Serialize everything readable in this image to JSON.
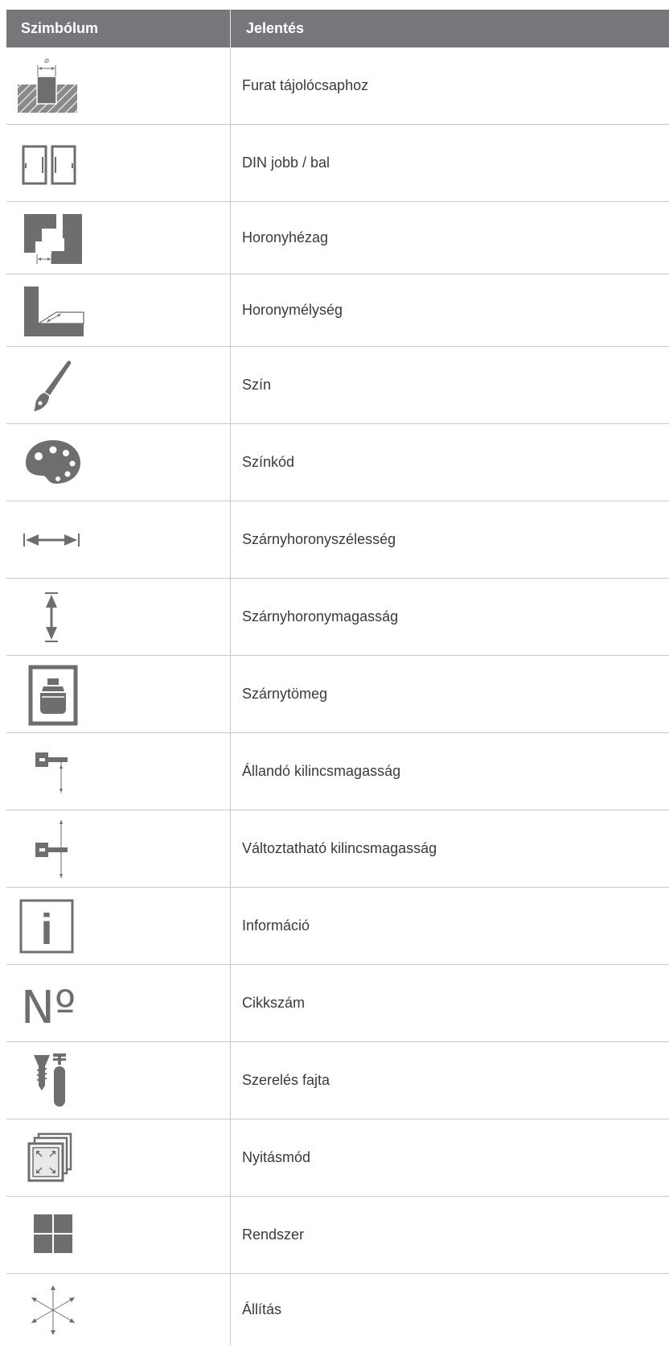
{
  "header": {
    "symbol": "Szimbólum",
    "meaning": "Jelentés"
  },
  "rows": [
    {
      "icon": "drill-hole-icon",
      "label": "Furat tájolócsaphoz",
      "glyph": "⌀"
    },
    {
      "icon": "din-left-right-icon",
      "label": "DIN jobb / bal"
    },
    {
      "icon": "groove-gap-icon",
      "label": "Horonyhézag"
    },
    {
      "icon": "groove-depth-icon",
      "label": "Horonymélység"
    },
    {
      "icon": "paintbrush-icon",
      "label": "Szín"
    },
    {
      "icon": "palette-icon",
      "label": "Színkód"
    },
    {
      "icon": "horizontal-width-icon",
      "label": "Szárnyhoronyszélesség"
    },
    {
      "icon": "vertical-height-icon",
      "label": "Szárnyhoronymagasság"
    },
    {
      "icon": "weight-icon",
      "label": "Szárnytömeg"
    },
    {
      "icon": "fixed-handle-height-icon",
      "label": "Állandó kilincsmagasság"
    },
    {
      "icon": "adjustable-handle-height-icon",
      "label": "Változtatható kilincsmagasság"
    },
    {
      "icon": "info-icon",
      "label": "Információ",
      "glyph": "i"
    },
    {
      "icon": "numero-icon",
      "label": "Cikkszám",
      "glyph": "Nº"
    },
    {
      "icon": "screw-mounting-icon",
      "label": "Szerelés fajta"
    },
    {
      "icon": "opening-mode-icon",
      "label": "Nyitásmód"
    },
    {
      "icon": "system-grid-icon",
      "label": "Rendszer"
    },
    {
      "icon": "adjustment-arrows-icon",
      "label": "Állítás"
    }
  ]
}
